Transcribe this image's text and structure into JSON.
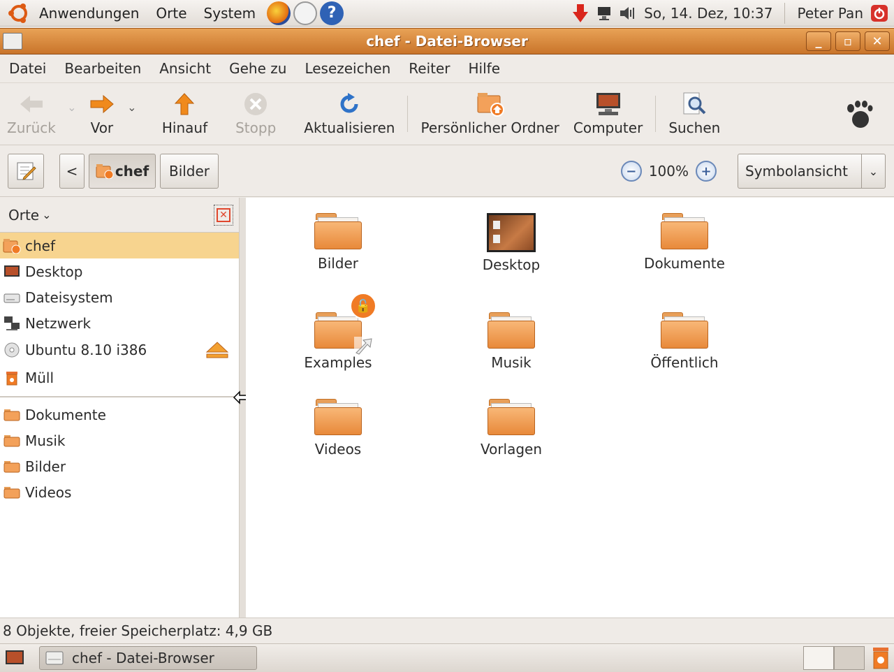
{
  "top_panel": {
    "menus": [
      "Anwendungen",
      "Orte",
      "System"
    ],
    "clock": "So, 14. Dez, 10:37",
    "user": "Peter Pan"
  },
  "window": {
    "title": "chef - Datei-Browser"
  },
  "menubar": {
    "items": [
      "Datei",
      "Bearbeiten",
      "Ansicht",
      "Gehe zu",
      "Lesezeichen",
      "Reiter",
      "Hilfe"
    ]
  },
  "toolbar": {
    "back": "Zurück",
    "forward": "Vor",
    "up": "Hinauf",
    "stop": "Stopp",
    "reload": "Aktualisieren",
    "home": "Persönlicher Ordner",
    "computer": "Computer",
    "search": "Suchen"
  },
  "location": {
    "back_arrow": "<",
    "crumbs": [
      "chef",
      "Bilder"
    ],
    "zoom": "100%",
    "view_mode": "Symbolansicht"
  },
  "sidebar": {
    "header": "Orte",
    "places": [
      "chef",
      "Desktop",
      "Dateisystem",
      "Netzwerk",
      "Ubuntu 8.10 i386",
      "Müll"
    ],
    "bookmarks": [
      "Dokumente",
      "Musik",
      "Bilder",
      "Videos"
    ]
  },
  "files": [
    "Bilder",
    "Desktop",
    "Dokumente",
    "Examples",
    "Musik",
    "Öffentlich",
    "Videos",
    "Vorlagen"
  ],
  "status": "8 Objekte, freier Speicherplatz: 4,9 GB",
  "taskbar": {
    "task": "chef - Datei-Browser"
  },
  "colors": {
    "accent": "#e8893a",
    "selection": "#f7d48f",
    "titlebar": "#d9863a"
  }
}
